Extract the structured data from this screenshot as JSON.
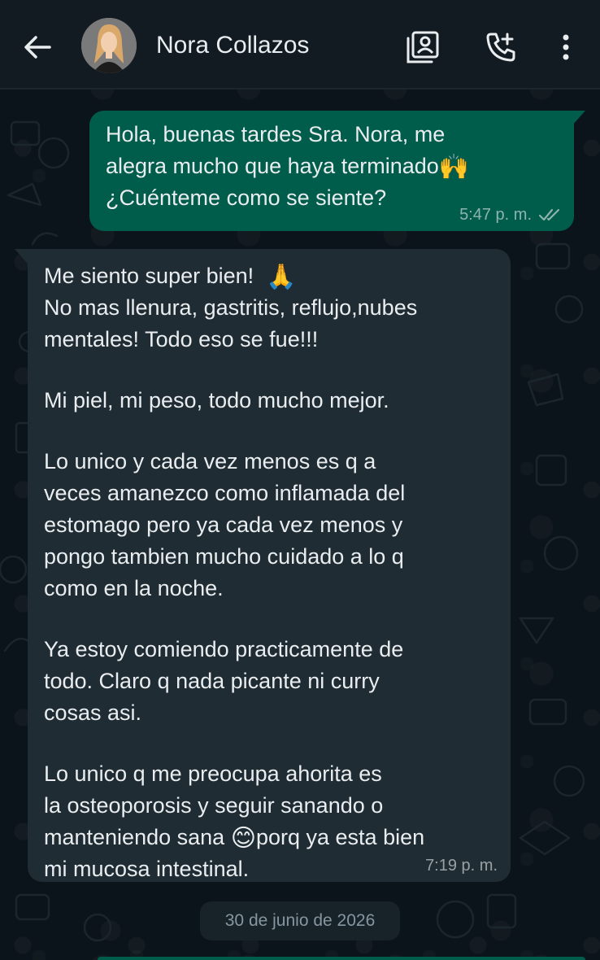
{
  "header": {
    "contact_name": "Nora Collazos",
    "icons": [
      "back-arrow-icon",
      "contact-card-icon",
      "add-call-icon",
      "more-vertical-icon"
    ]
  },
  "messages": [
    {
      "direction": "outgoing",
      "lines": [
        "Hola, buenas tardes Sra. Nora, me",
        "alegra mucho que haya terminado",
        "¿Cuénteme como se siente?"
      ],
      "emoji": "🙌",
      "time": "5:47 p. m.",
      "status": "read"
    },
    {
      "direction": "incoming",
      "lines": [
        "Me siento super bien!",
        "No mas llenura, gastritis, reflujo,nubes",
        "mentales! Todo eso se fue!!!",
        "",
        "Mi piel, mi peso, todo mucho mejor.",
        "",
        "Lo unico y cada vez menos es q a",
        "veces amanezco como inflamada del",
        "estomago pero ya cada vez menos y",
        "pongo tambien mucho cuidado a lo q",
        "como en la noche.",
        "",
        "Ya estoy comiendo practicamente de",
        "todo.  Claro q nada picante ni curry",
        "cosas asi.",
        "",
        "Lo unico q me preocupa ahorita es",
        "la osteoporosis y seguir sanando o",
        "manteniendo sana",
        "porq ya esta bien",
        "mi mucosa intestinal."
      ],
      "emojis": [
        "🙏",
        "😊"
      ],
      "time": "7:19 p. m."
    }
  ],
  "date_chip": "30 de junio de 2026",
  "colors": {
    "background": "#0b141a",
    "header": "#121b22",
    "outgoing_bubble": "#005c4b",
    "incoming_bubble": "#202c33",
    "text": "#e9edef",
    "meta": "#8696a0"
  }
}
